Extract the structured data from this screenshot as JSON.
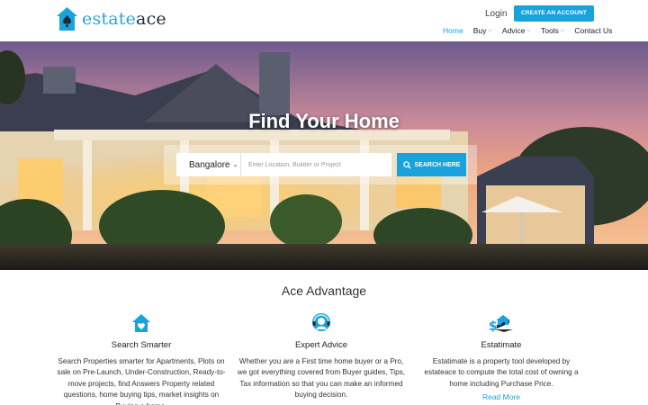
{
  "brand": {
    "name_part1": "estate",
    "name_part2": "ace",
    "color": "#18a3dd"
  },
  "header": {
    "login_label": "Login",
    "create_account_label": "CREATE AN ACCOUNT",
    "nav": [
      {
        "label": "Home",
        "active": true,
        "dropdown": false
      },
      {
        "label": "Buy",
        "active": false,
        "dropdown": true
      },
      {
        "label": "Advice",
        "active": false,
        "dropdown": true
      },
      {
        "label": "Tools",
        "active": false,
        "dropdown": true
      },
      {
        "label": "Contact Us",
        "active": false,
        "dropdown": false
      }
    ]
  },
  "hero": {
    "title": "Find Your Home",
    "city": "Bangalore",
    "search_placeholder": "Enter Location, Builder or Project",
    "search_button_label": "SEARCH HERE"
  },
  "advantage": {
    "title": "Ace Advantage",
    "features": [
      {
        "icon": "home-heart-icon",
        "name": "Search Smarter",
        "description": "Search Properties smarter for Apartments, Plots on sale on Pre-Launch, Under-Construction, Ready-to-move projects, find Answers Property related questions, home buying tips, market insights on Buying a home."
      },
      {
        "icon": "headset-icon",
        "name": "Expert Advice",
        "description": "Whether you are a First time home buyer or a Pro, we got everything covered from Buyer guides, Tips, Tax information so that you can make an informed buying decision."
      },
      {
        "icon": "money-home-icon",
        "name": "Estatimate",
        "description": "Estatimate is a property tool developed by estateace to compute the total cost of owning a home including Purchase Price.",
        "link": "Read More"
      }
    ]
  }
}
